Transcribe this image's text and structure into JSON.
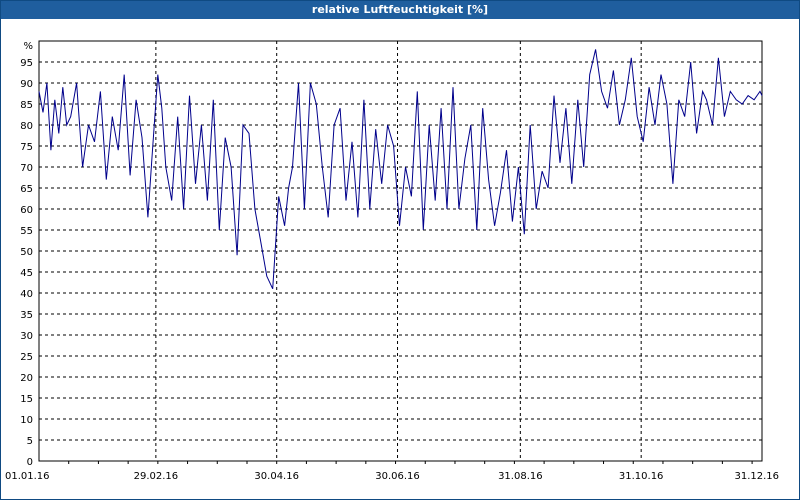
{
  "window": {
    "title": "relative Luftfeuchtigkeit [%]"
  },
  "chart_data": {
    "type": "line",
    "title": "relative Luftfeuchtigkeit [%]",
    "y_unit": "%",
    "xlim": [
      "2016-01-01",
      "2016-12-31"
    ],
    "ylim": [
      0,
      100
    ],
    "y_ticks": [
      0,
      5,
      10,
      15,
      20,
      25,
      30,
      35,
      40,
      45,
      50,
      55,
      60,
      65,
      70,
      75,
      80,
      85,
      90,
      95
    ],
    "x_ticks": [
      {
        "date": "2016-01-01",
        "label": "01.01.16"
      },
      {
        "date": "2016-02-29",
        "label": "29.02.16"
      },
      {
        "date": "2016-04-30",
        "label": "30.04.16"
      },
      {
        "date": "2016-06-30",
        "label": "30.06.16"
      },
      {
        "date": "2016-08-31",
        "label": "31.08.16"
      },
      {
        "date": "2016-10-31",
        "label": "31.10.16"
      },
      {
        "date": "2016-12-31",
        "label": "31.12.16"
      }
    ],
    "grid": true,
    "line_color": "#00008b",
    "series": [
      {
        "x": [
          "2016-01-01",
          "2016-01-03",
          "2016-01-05",
          "2016-01-07",
          "2016-01-09",
          "2016-01-11",
          "2016-01-13",
          "2016-01-15",
          "2016-01-17",
          "2016-01-20",
          "2016-01-23",
          "2016-01-26",
          "2016-01-29",
          "2016-02-01",
          "2016-02-04",
          "2016-02-07",
          "2016-02-10",
          "2016-02-13",
          "2016-02-16",
          "2016-02-19",
          "2016-02-22",
          "2016-02-25",
          "2016-02-27",
          "2016-03-01",
          "2016-03-03",
          "2016-03-05",
          "2016-03-08",
          "2016-03-11",
          "2016-03-14",
          "2016-03-17",
          "2016-03-20",
          "2016-03-23",
          "2016-03-26",
          "2016-03-29",
          "2016-04-01",
          "2016-04-04",
          "2016-04-07",
          "2016-04-10",
          "2016-04-13",
          "2016-04-16",
          "2016-04-19",
          "2016-04-22",
          "2016-04-25",
          "2016-04-28",
          "2016-05-01",
          "2016-05-04",
          "2016-05-06",
          "2016-05-08",
          "2016-05-11",
          "2016-05-14",
          "2016-05-17",
          "2016-05-20",
          "2016-05-23",
          "2016-05-26",
          "2016-05-29",
          "2016-06-01",
          "2016-06-04",
          "2016-06-07",
          "2016-06-10",
          "2016-06-13",
          "2016-06-16",
          "2016-06-19",
          "2016-06-22",
          "2016-06-25",
          "2016-06-28",
          "2016-07-01",
          "2016-07-04",
          "2016-07-07",
          "2016-07-10",
          "2016-07-13",
          "2016-07-16",
          "2016-07-19",
          "2016-07-22",
          "2016-07-25",
          "2016-07-28",
          "2016-07-31",
          "2016-08-03",
          "2016-08-06",
          "2016-08-09",
          "2016-08-12",
          "2016-08-15",
          "2016-08-18",
          "2016-08-21",
          "2016-08-24",
          "2016-08-27",
          "2016-08-30",
          "2016-09-02",
          "2016-09-05",
          "2016-09-08",
          "2016-09-11",
          "2016-09-14",
          "2016-09-17",
          "2016-09-20",
          "2016-09-23",
          "2016-09-26",
          "2016-09-29",
          "2016-10-02",
          "2016-10-05",
          "2016-10-08",
          "2016-10-11",
          "2016-10-14",
          "2016-10-17",
          "2016-10-20",
          "2016-10-23",
          "2016-10-26",
          "2016-10-29",
          "2016-11-01",
          "2016-11-04",
          "2016-11-07",
          "2016-11-10",
          "2016-11-13",
          "2016-11-16",
          "2016-11-19",
          "2016-11-22",
          "2016-11-25",
          "2016-11-28",
          "2016-12-01",
          "2016-12-03",
          "2016-12-06",
          "2016-12-09",
          "2016-12-12",
          "2016-12-15",
          "2016-12-18",
          "2016-12-21",
          "2016-12-24",
          "2016-12-27",
          "2016-12-30",
          "2016-12-31"
        ],
        "y": [
          88,
          83,
          90,
          74,
          86,
          78,
          89,
          80,
          82,
          90,
          70,
          80,
          76,
          88,
          67,
          82,
          74,
          92,
          68,
          86,
          77,
          58,
          72,
          92,
          84,
          70,
          62,
          82,
          60,
          87,
          66,
          80,
          62,
          86,
          55,
          77,
          70,
          49,
          80,
          78,
          60,
          52,
          44,
          41,
          63,
          56,
          65,
          70,
          90,
          60,
          90,
          85,
          70,
          58,
          80,
          84,
          62,
          76,
          58,
          86,
          60,
          79,
          66,
          80,
          75,
          56,
          70,
          63,
          88,
          55,
          80,
          62,
          84,
          60,
          89,
          60,
          72,
          80,
          55,
          84,
          67,
          56,
          64,
          74,
          57,
          70,
          54,
          80,
          60,
          69,
          65,
          87,
          71,
          84,
          66,
          86,
          70,
          92,
          98,
          88,
          84,
          93,
          80,
          86,
          96,
          82,
          76,
          89,
          80,
          92,
          85,
          66,
          86,
          82,
          95,
          78,
          88,
          86,
          80,
          96,
          82,
          88,
          86,
          85,
          87,
          86,
          88,
          87
        ]
      }
    ]
  }
}
